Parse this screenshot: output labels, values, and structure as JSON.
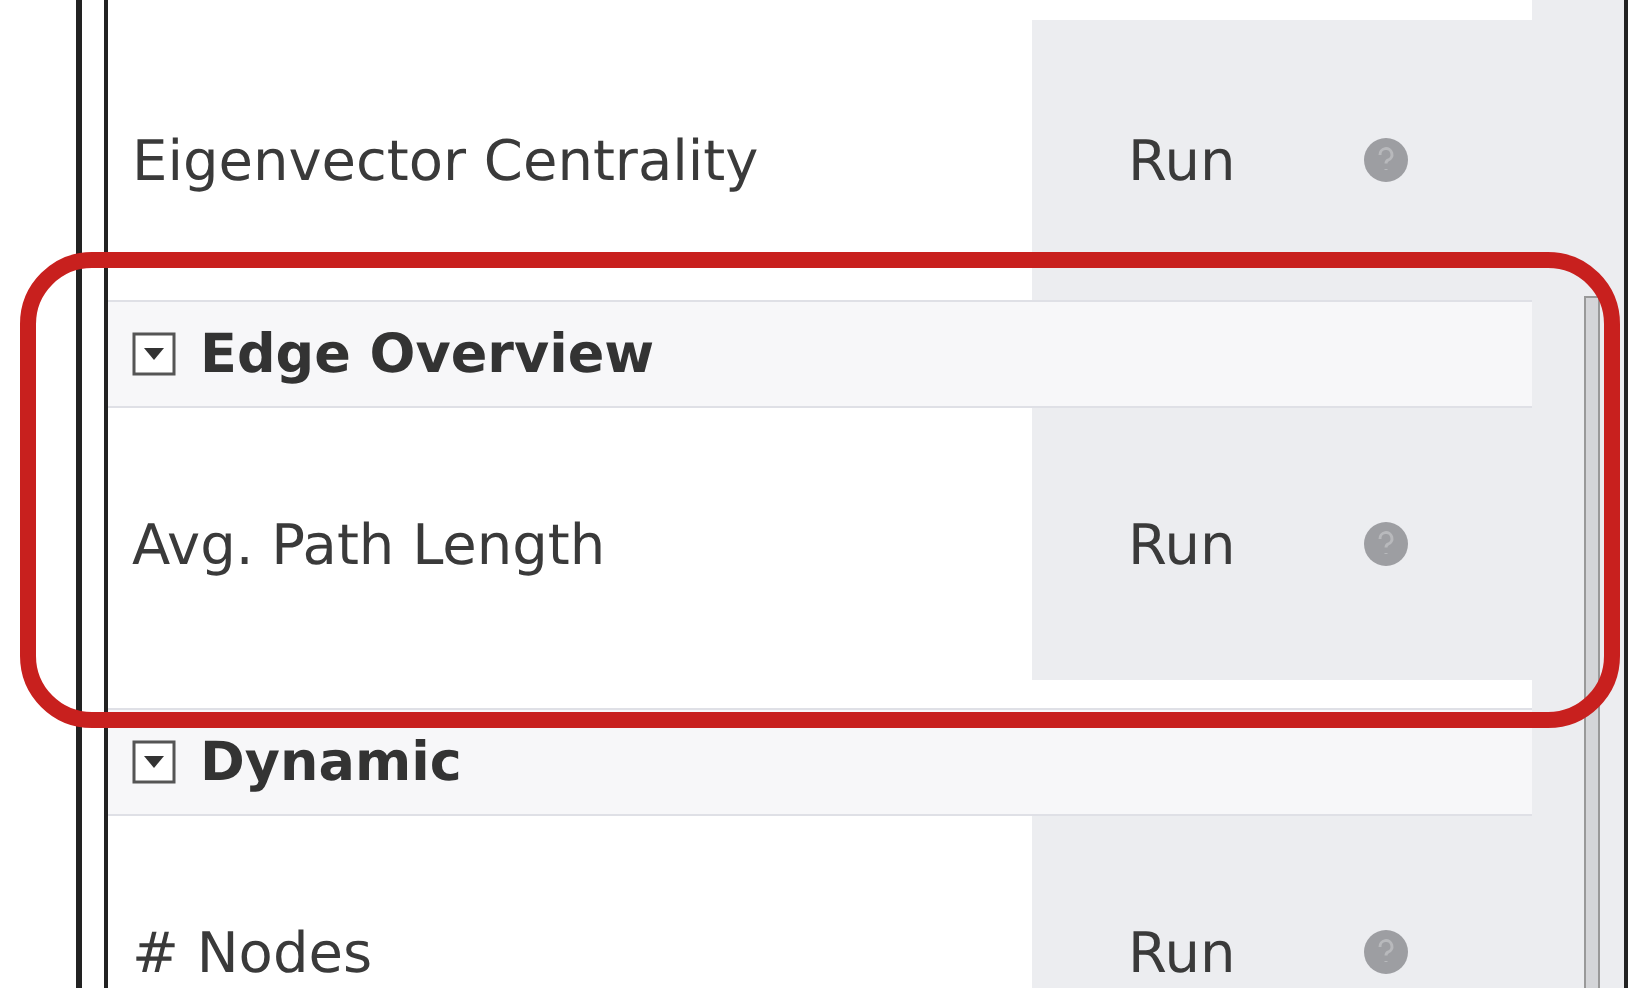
{
  "statistics": [
    {
      "kind": "row",
      "name": "Eigenvector Centrality",
      "button": "Run"
    },
    {
      "kind": "section",
      "title": "Edge Overview",
      "expanded": true,
      "highlighted": true
    },
    {
      "kind": "row",
      "name": "Avg. Path Length",
      "button": "Run",
      "highlighted": true
    },
    {
      "kind": "section",
      "title": "Dynamic",
      "expanded": true
    },
    {
      "kind": "row",
      "name": "# Nodes",
      "button": "Run"
    }
  ]
}
